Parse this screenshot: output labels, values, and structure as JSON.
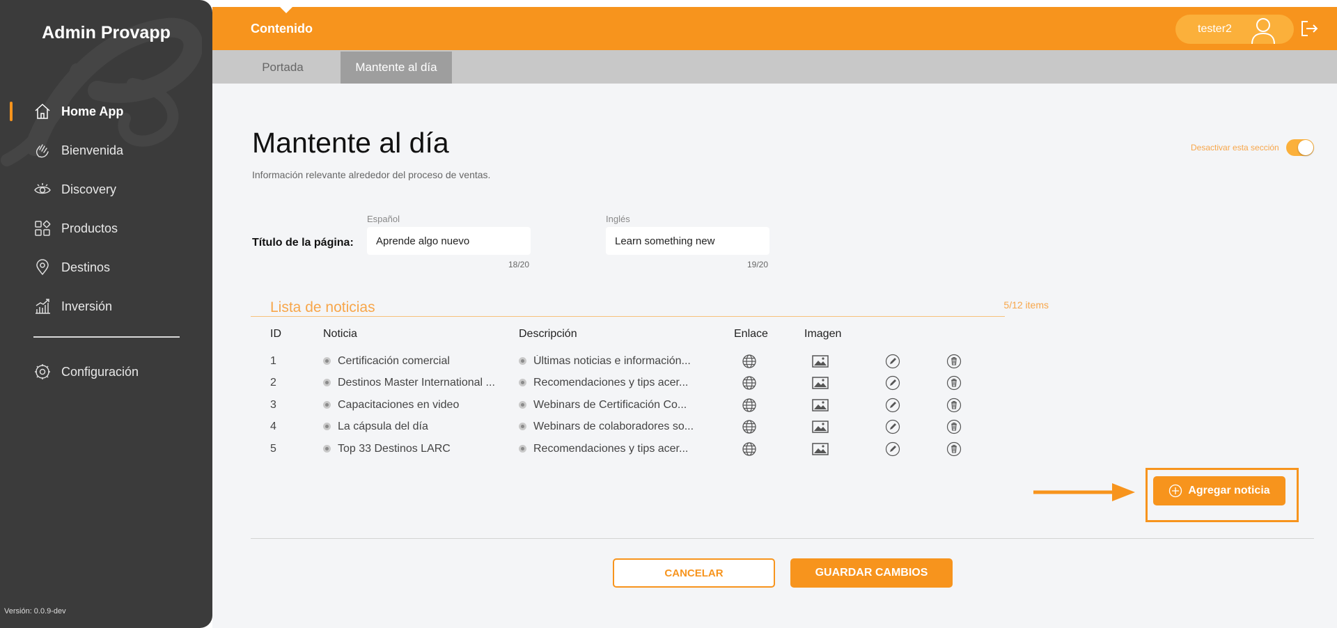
{
  "app": {
    "brand": "Admin Provapp",
    "version": "Versión: 0.0.9-dev"
  },
  "sidebar": {
    "items": [
      {
        "label": "Home App",
        "icon": "home-icon",
        "active": true
      },
      {
        "label": "Bienvenida",
        "icon": "waving-hand-icon"
      },
      {
        "label": "Discovery",
        "icon": "eye-icon"
      },
      {
        "label": "Productos",
        "icon": "grid-icon"
      },
      {
        "label": "Destinos",
        "icon": "location-pin-icon"
      },
      {
        "label": "Inversión",
        "icon": "bar-chart-growth-icon"
      }
    ],
    "config": {
      "label": "Configuración",
      "icon": "settings-icon"
    }
  },
  "topbar": {
    "title": "Contenido",
    "user": "tester2",
    "user_icon": "user-avatar-icon",
    "logout_icon": "logout-icon"
  },
  "subtabs": [
    {
      "label": "Portada",
      "active": false
    },
    {
      "label": "Mantente al día",
      "active": true
    }
  ],
  "page": {
    "title": "Mantente al día",
    "subtitle": "Información relevante alrededor del proceso de ventas.",
    "toggle_label": "Desactivar esta sección",
    "toggle_on": true
  },
  "form": {
    "label": "Título de la página:",
    "es": {
      "lang": "Español",
      "value": "Aprende algo nuevo",
      "counter": "18/20"
    },
    "en": {
      "lang": "Inglés",
      "value": "Learn something new",
      "counter": "19/20"
    }
  },
  "news": {
    "title": "Lista de noticias",
    "count": "5/12 items",
    "headers": {
      "id": "ID",
      "news": "Noticia",
      "desc": "Descripción",
      "link": "Enlace",
      "image": "Imagen"
    },
    "rows": [
      {
        "id": "1",
        "news": "Certificación comercial",
        "desc": "Últimas noticias e información..."
      },
      {
        "id": "2",
        "news": "Destinos Master International ...",
        "desc": "Recomendaciones y tips acer..."
      },
      {
        "id": "3",
        "news": "Capacitaciones en video",
        "desc": "Webinars de Certificación Co..."
      },
      {
        "id": "4",
        "news": "La cápsula del día",
        "desc": "Webinars de colaboradores so..."
      },
      {
        "id": "5",
        "news": "Top 33 Destinos LARC",
        "desc": "Recomendaciones y tips acer..."
      }
    ],
    "row_icons": [
      "globe-icon",
      "image-icon",
      "edit-pencil-icon",
      "trash-icon"
    ]
  },
  "actions": {
    "add": "Agregar noticia",
    "cancel": "CANCELAR",
    "save": "GUARDAR CAMBIOS"
  },
  "colors": {
    "accent": "#f7941d",
    "sidebar": "#3b3b3b",
    "background": "#f4f5f7"
  }
}
